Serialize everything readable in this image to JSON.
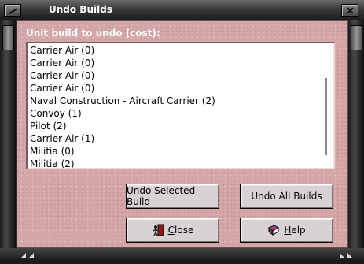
{
  "window": {
    "title": "Undo Builds"
  },
  "dialog": {
    "label": "Unit build to undo (cost):",
    "list_items": [
      "Carrier Air (0)",
      "Carrier Air (0)",
      "Carrier Air (0)",
      "Carrier Air (0)",
      "Naval Construction - Aircraft Carrier (2)",
      "Convoy (1)",
      "Pilot (2)",
      "Carrier Air (1)",
      "Militia (0)",
      "Militia (2)"
    ],
    "buttons": {
      "undo_selected": "Undo Selected Build",
      "undo_all": "Undo All Builds",
      "close_first": "C",
      "close_rest": "lose",
      "help_first": "H",
      "help_rest": "elp"
    }
  },
  "icons": {
    "close": "exit-door-icon",
    "help": "help-book-icon",
    "title_left": "window-menu-icon",
    "title_right": "close-window-icon"
  },
  "colors": {
    "background": "#d4a7a8",
    "label_text": "#ffffff",
    "titlebar": "#3b3b3b"
  }
}
